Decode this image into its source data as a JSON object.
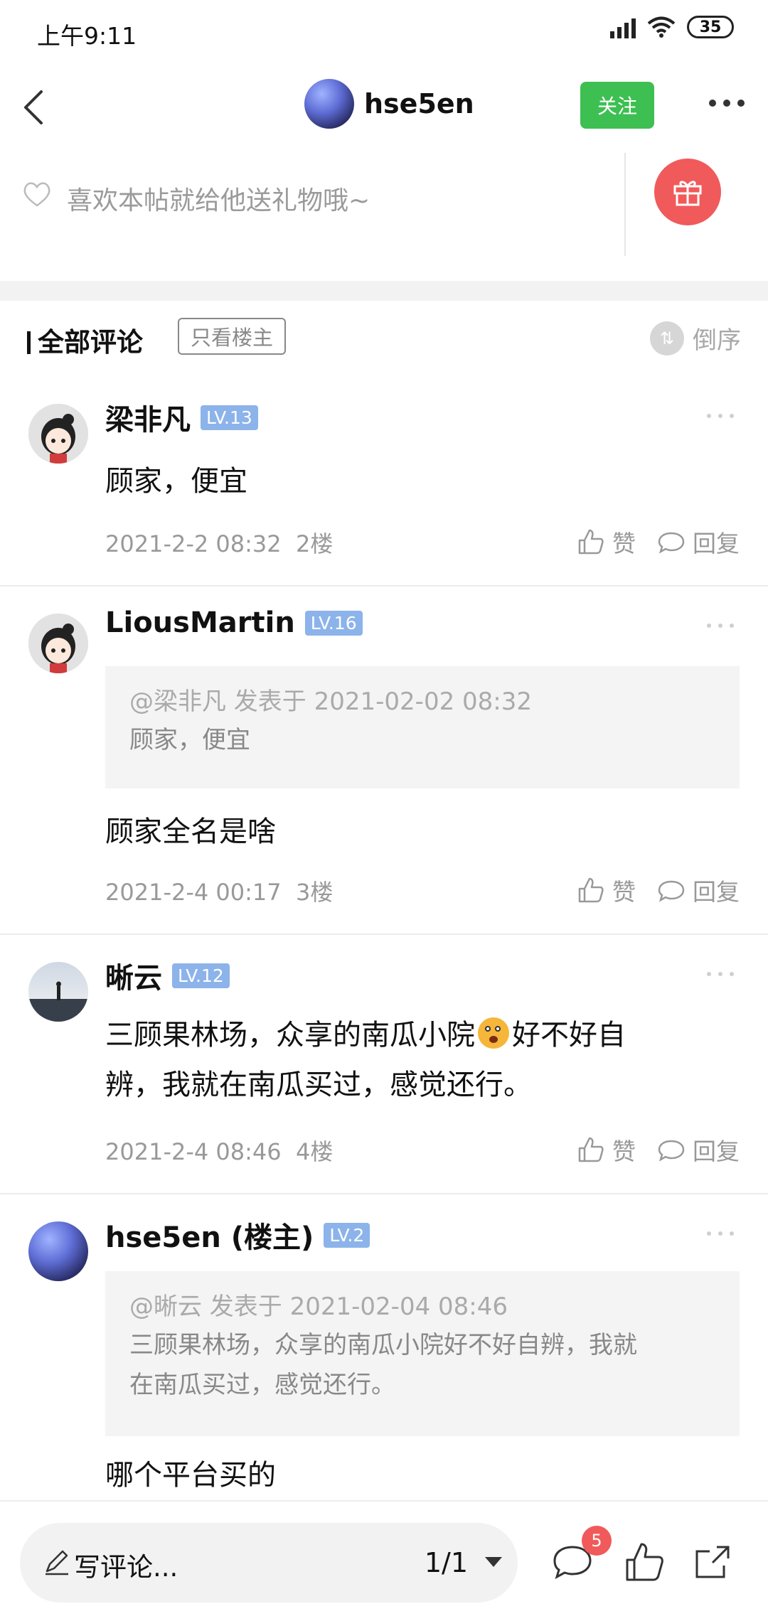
{
  "status_bar": {
    "time": "上午9:11",
    "battery": "35"
  },
  "header": {
    "username": "hse5en",
    "follow_label": "关注"
  },
  "gift": {
    "prompt": "喜欢本帖就给他送礼物哦~"
  },
  "comments_header": {
    "title": "全部评论",
    "owner_only": "只看楼主",
    "order_label": "倒序"
  },
  "comments": [
    {
      "name": "梁非凡",
      "level": "LV.13",
      "text": "顾家，便宜",
      "date": "2021-2-2 08:32",
      "floor": "2楼",
      "like_label": "赞",
      "reply_label": "回复"
    },
    {
      "name": "LiousMartin",
      "level": "LV.16",
      "quote_meta": "@梁非凡 发表于 2021-02-02 08:32",
      "quote_text": "顾家，便宜",
      "text": "顾家全名是啥",
      "date": "2021-2-4 00:17",
      "floor": "3楼",
      "like_label": "赞",
      "reply_label": "回复"
    },
    {
      "name": "晰云",
      "level": "LV.12",
      "text_line1": "三顾果林场，众享的南瓜小院",
      "text_line1b": "好不好自",
      "text_line2": "辨，我就在南瓜买过，感觉还行。",
      "date": "2021-2-4 08:46",
      "floor": "4楼",
      "like_label": "赞",
      "reply_label": "回复"
    },
    {
      "name": "hse5en (楼主)",
      "level": "LV.2",
      "quote_meta": "@晰云 发表于 2021-02-04 08:46",
      "quote_line1": "三顾果林场，众享的南瓜小院好不好自辨，我就",
      "quote_line2": "在南瓜买过，感觉还行。",
      "text": "哪个平台买的"
    }
  ],
  "bottom_bar": {
    "write_label": "写评论...",
    "page": "1/1",
    "comment_count": "5"
  },
  "colors": {
    "follow_green": "#3dbf52",
    "gift_red": "#f15a5a",
    "level_blue": "#8cb3ea"
  }
}
